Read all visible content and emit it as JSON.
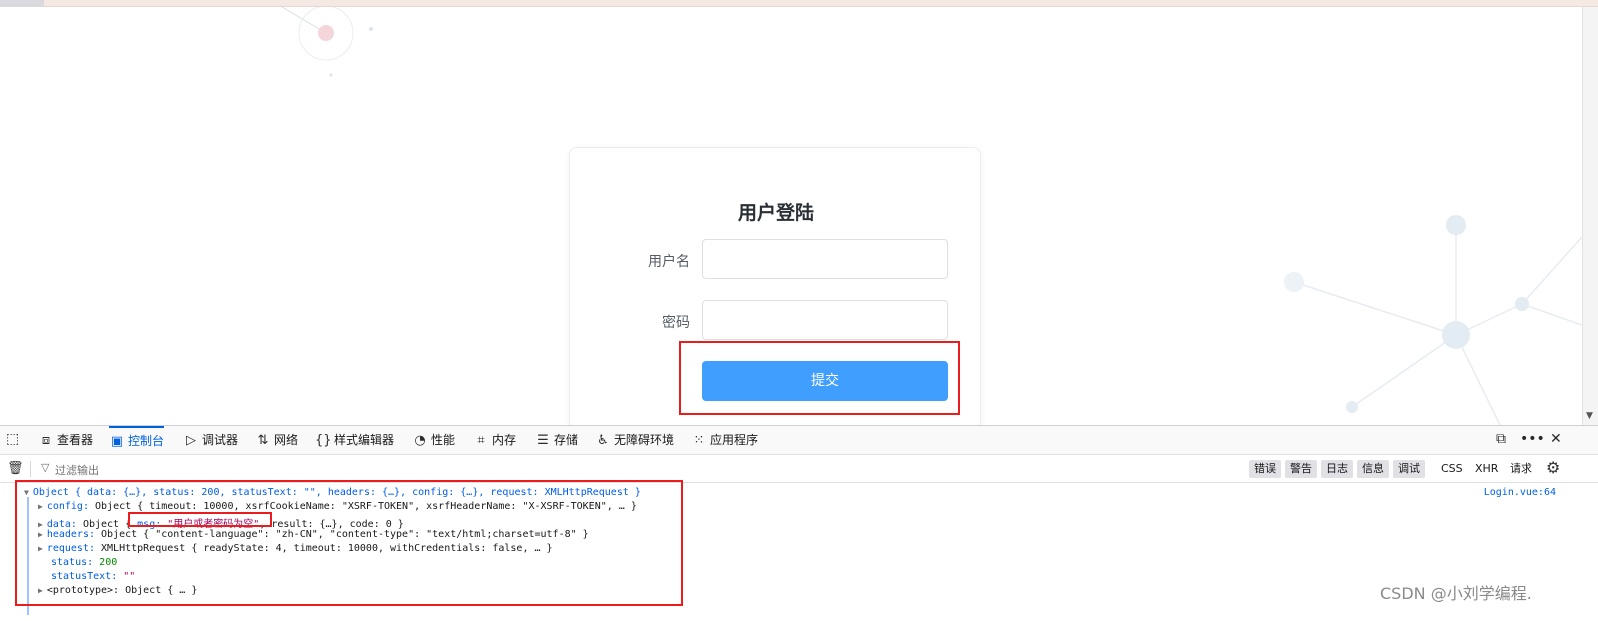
{
  "login": {
    "title": "用户登陆",
    "username_label": "用户名",
    "password_label": "密码",
    "submit_label": "提交"
  },
  "devtools": {
    "tabs": [
      {
        "label": "查看器",
        "icon": "inspector-icon"
      },
      {
        "label": "控制台",
        "icon": "console-icon"
      },
      {
        "label": "调试器",
        "icon": "debugger-icon"
      },
      {
        "label": "网络",
        "icon": "network-icon"
      },
      {
        "label": "样式编辑器",
        "icon": "style-editor-icon"
      },
      {
        "label": "性能",
        "icon": "performance-icon"
      },
      {
        "label": "内存",
        "icon": "memory-icon"
      },
      {
        "label": "存储",
        "icon": "storage-icon"
      },
      {
        "label": "无障碍环境",
        "icon": "accessibility-icon"
      },
      {
        "label": "应用程序",
        "icon": "application-icon"
      }
    ],
    "active_tab": "控制台",
    "filter_placeholder": "过滤输出",
    "levels": [
      "错误",
      "警告",
      "日志",
      "信息",
      "调试"
    ],
    "type_filters": [
      "CSS",
      "XHR",
      "请求"
    ]
  },
  "console": {
    "source_link": "Login.vue:64",
    "line1": "Object { data: {…}, status: 200, statusText: \"\", headers: {…}, config: {…}, request: XMLHttpRequest }",
    "config_key": "config:",
    "config_val": " Object { timeout: 10000, xsrfCookieName: \"XSRF-TOKEN\", xsrfHeaderName: \"X-XSRF-TOKEN\", … }",
    "data_key": "data:",
    "data_prefix": " Object { ",
    "msg_key": "msg: ",
    "msg_val": "\"用户或者密码为空\"",
    "data_suffix": ", result: {…}, code: 0 }",
    "headers_key": "headers:",
    "headers_val": " Object { \"content-language\": \"zh-CN\", \"content-type\": \"text/html;charset=utf-8\" }",
    "request_key": "request:",
    "request_val": " XMLHttpRequest { readyState: 4, timeout: 10000, withCredentials: false, … }",
    "status_key": "status: ",
    "status_val": "200",
    "statusText_key": "statusText: ",
    "statusText_val": "\"\"",
    "prototype_key": "<prototype>:",
    "prototype_val": " Object { … }"
  },
  "watermark": "CSDN @小刘学编程.",
  "colors": {
    "primary_button": "#409eff",
    "highlight_box": "#ea1c1c",
    "devtools_active": "#0061e0"
  }
}
